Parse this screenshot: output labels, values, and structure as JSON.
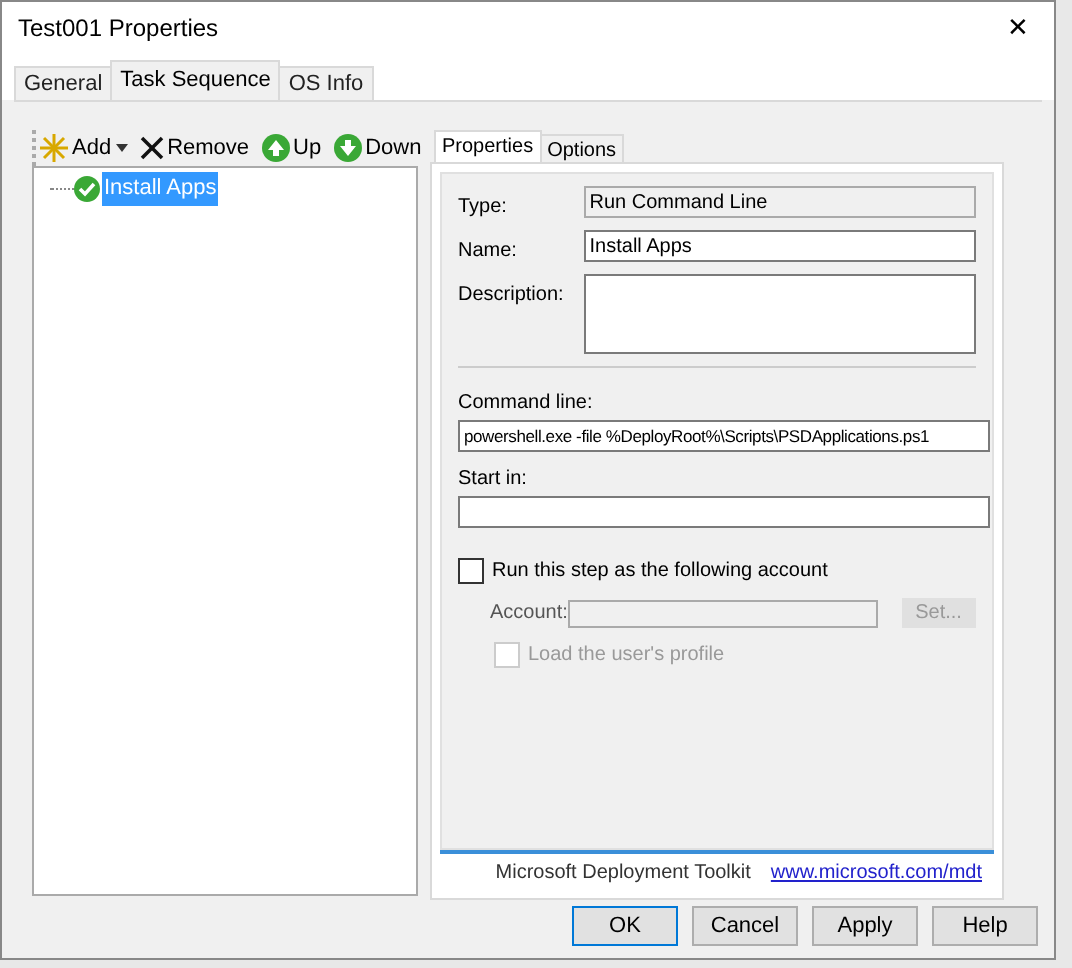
{
  "window": {
    "title": "Test001 Properties",
    "close": "✕"
  },
  "tabs": [
    {
      "label": "General",
      "selected": false
    },
    {
      "label": "Task Sequence",
      "selected": true
    },
    {
      "label": "OS Info",
      "selected": false
    }
  ],
  "toolbar": [
    {
      "kind": "add",
      "label": "Add",
      "dropdown": true
    },
    {
      "kind": "remove",
      "label": "Remove",
      "dropdown": false
    },
    {
      "kind": "up",
      "label": "Up",
      "dropdown": false
    },
    {
      "kind": "down",
      "label": "Down",
      "dropdown": false
    }
  ],
  "tree": [
    {
      "label": "Install Apps",
      "selected": true
    }
  ],
  "inner_tabs": [
    {
      "label": "Properties",
      "selected": true
    },
    {
      "label": "Options",
      "selected": false
    }
  ],
  "fields": [
    {
      "kind": "readonly",
      "label": "Type:",
      "value": "Run Command Line"
    },
    {
      "kind": "text",
      "label": "Name:",
      "value": "Install Apps"
    },
    {
      "kind": "area",
      "label": "Description:"
    }
  ],
  "command_line": {
    "label": "Command line:",
    "value": "powershell.exe -file %DeployRoot%\\Scripts\\PSDApplications.ps1"
  },
  "start_in": {
    "label": "Start in:"
  },
  "run_as": {
    "label": "Run this step as the following account",
    "checked": false
  },
  "account": {
    "label": "Account:",
    "disabled": true,
    "set_button": "Set..."
  },
  "load_profile": {
    "label": "Load the user's profile",
    "checked": false,
    "disabled": true
  },
  "footer": {
    "product": "Microsoft Deployment Toolkit",
    "link": "www.microsoft.com/mdt"
  },
  "buttons": [
    "OK",
    "Cancel",
    "Apply",
    "Help"
  ]
}
